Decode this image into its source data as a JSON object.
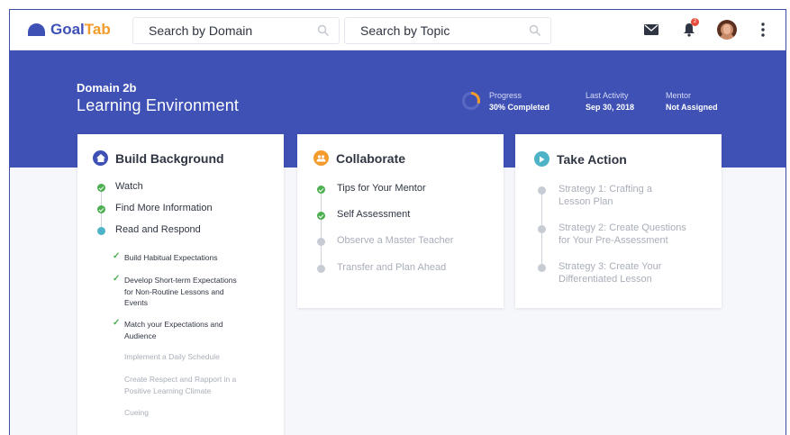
{
  "app": {
    "logo_part1": "Goal",
    "logo_part2": "Tab"
  },
  "search": {
    "domain_placeholder": "Search by Domain",
    "topic_placeholder": "Search by Topic"
  },
  "notifications": {
    "badge_count": "2"
  },
  "banner": {
    "domain_label": "Domain 2b",
    "domain_title": "Learning Environment",
    "progress_label": "Progress",
    "progress_value": "30% Completed",
    "progress_fraction": 0.3,
    "last_activity_label": "Last Activity",
    "last_activity_value": "Sep 30, 2018",
    "mentor_label": "Mentor",
    "mentor_value": "Not Assigned"
  },
  "cards": [
    {
      "title": "Build Background",
      "steps": [
        {
          "label": "Watch",
          "status": "done"
        },
        {
          "label": "Find More Information",
          "status": "done"
        },
        {
          "label": "Read and Respond",
          "status": "current"
        }
      ],
      "substeps": [
        {
          "lines": [
            "Build Habitual Expectations"
          ],
          "done": true
        },
        {
          "lines": [
            "Develop Short-term Expectations",
            "for Non-Routine Lessons and",
            "Events"
          ],
          "done": true
        },
        {
          "lines": [
            "Match your Expectations and",
            "Audience"
          ],
          "done": true
        },
        {
          "lines": [
            "Implement a Daily Schedule"
          ],
          "done": false
        },
        {
          "lines": [
            "Create Respect and Rapport in a",
            "Positive Learning Climate"
          ],
          "done": false
        },
        {
          "lines": [
            "Cueing"
          ],
          "done": false
        }
      ]
    },
    {
      "title": "Collaborate",
      "steps": [
        {
          "label": "Tips for Your Mentor",
          "status": "done"
        },
        {
          "label": "Self Assessment",
          "status": "done"
        },
        {
          "label": "Observe a Master Teacher",
          "status": "todo"
        },
        {
          "label": "Transfer and Plan Ahead",
          "status": "todo"
        }
      ]
    },
    {
      "title": "Take Action",
      "steps": [
        {
          "lines": [
            "Strategy 1: Crafting a",
            "Lesson Plan"
          ],
          "status": "todo"
        },
        {
          "lines": [
            "Strategy 2: Create Questions",
            "for Your Pre-Assessment"
          ],
          "status": "todo"
        },
        {
          "lines": [
            "Strategy 3: Create Your",
            "Differentiated Lesson"
          ],
          "status": "todo"
        }
      ]
    }
  ],
  "colors": {
    "brand_blue": "#3f51b5",
    "brand_orange": "#f39c2c",
    "done_green": "#4caf50",
    "current_teal": "#4fb3c8",
    "todo_gray": "#c7cbd3"
  },
  "icons": [
    "search-icon",
    "mail-icon",
    "bell-icon",
    "kebab-menu-icon",
    "home-icon",
    "people-icon",
    "play-icon",
    "check-icon"
  ]
}
